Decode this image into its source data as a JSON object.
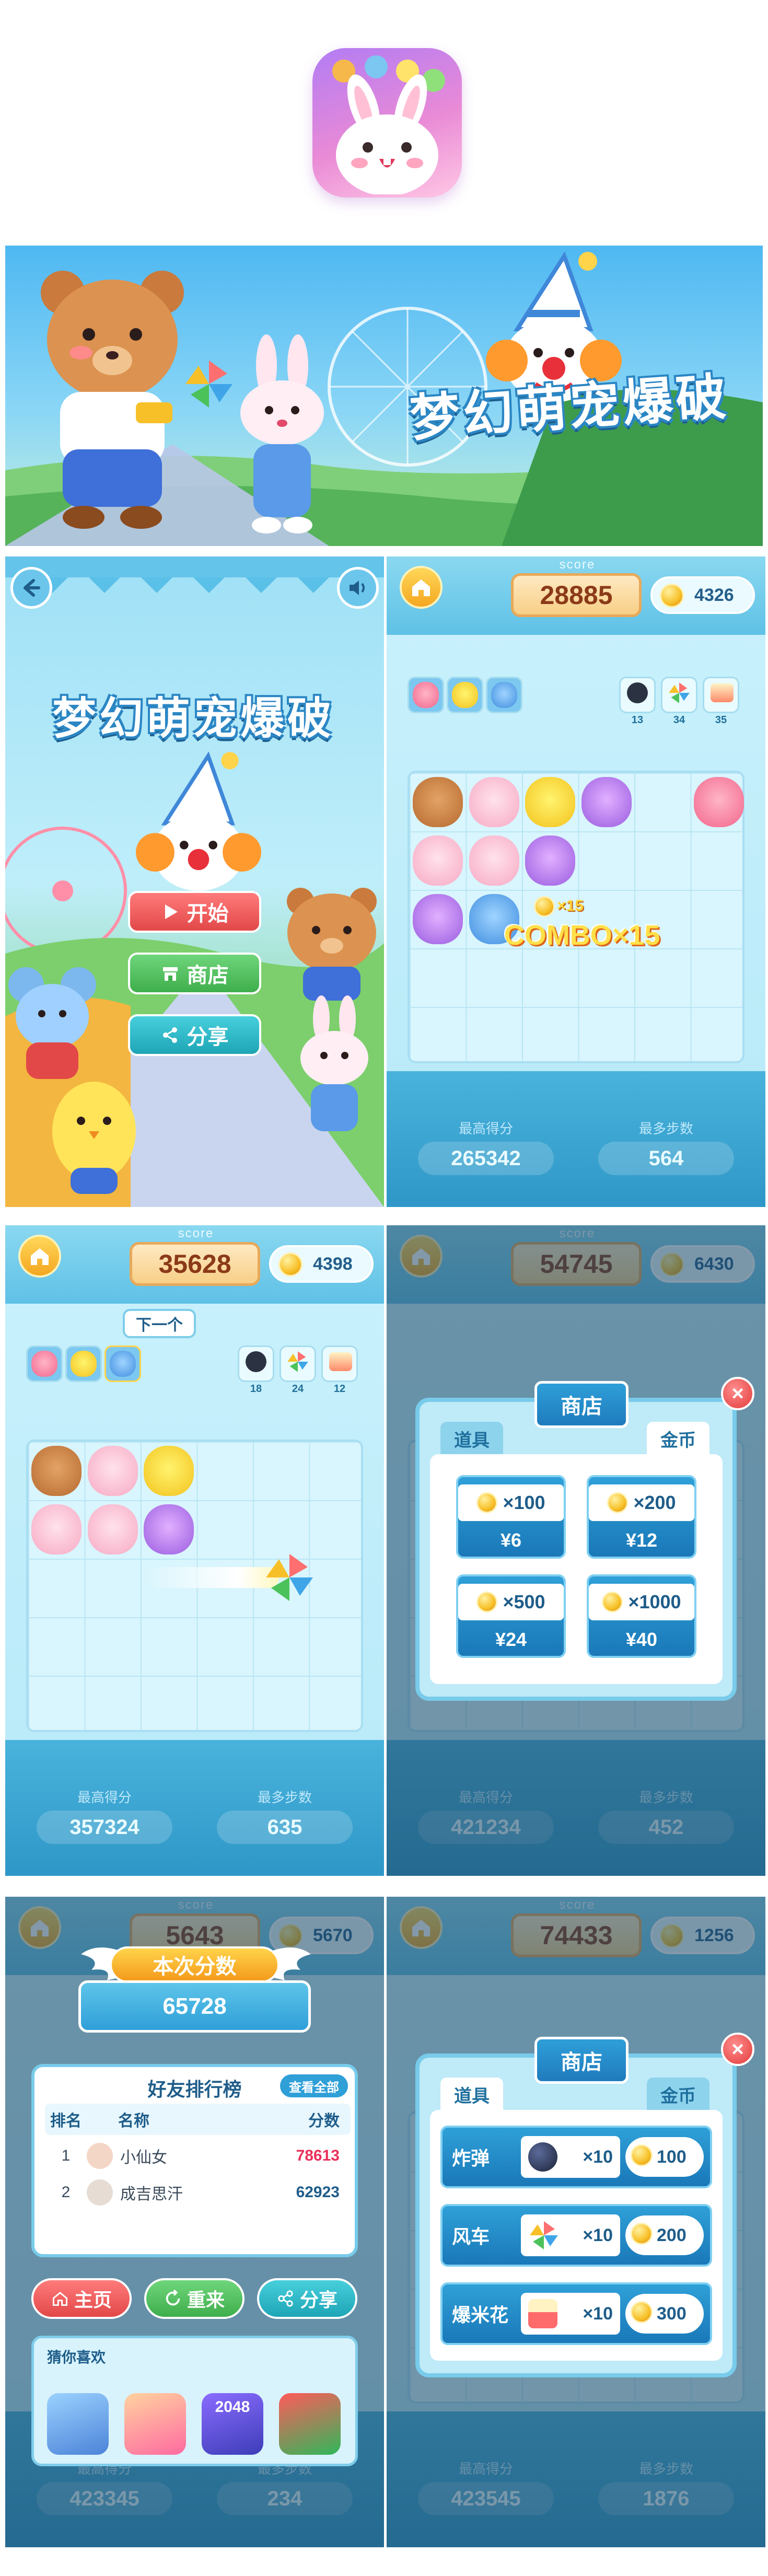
{
  "colors": {
    "accent_blue": "#2f9fd8",
    "coin_gold": "#f7c028",
    "score_brown": "#8b3a18",
    "start_red": "#ef5a5a",
    "shop_green": "#4cc25a",
    "share_teal": "#2fb7c6"
  },
  "game_title": "梦幻萌宠爆破",
  "menu": {
    "start_label": "开始",
    "shop_label": "商店",
    "share_label": "分享",
    "start_icon": "play-icon",
    "shop_icon": "store-icon",
    "share_icon": "share-icon"
  },
  "common": {
    "score_caption": "score",
    "best_score_label": "最高得分",
    "most_steps_label": "最多步数"
  },
  "screen_combo": {
    "score": "28885",
    "coins": "4326",
    "powerups": [
      "13",
      "34",
      "35"
    ],
    "combo_small": "×15",
    "combo_text": "COMBO×15",
    "best_score": "265342",
    "most_steps": "564"
  },
  "screen_tutorial": {
    "score": "35628",
    "coins": "4398",
    "hint": "下一个",
    "powerups": [
      "18",
      "24",
      "12"
    ],
    "best_score": "357324",
    "most_steps": "635"
  },
  "screen_shop_coins": {
    "score": "54745",
    "coins": "6430",
    "title": "商店",
    "tab_items": "道具",
    "tab_coins": "金币",
    "close_icon": "close-icon",
    "packs": [
      {
        "amount": "×100",
        "price": "¥6"
      },
      {
        "amount": "×200",
        "price": "¥12"
      },
      {
        "amount": "×500",
        "price": "¥24"
      },
      {
        "amount": "×1000",
        "price": "¥40"
      }
    ],
    "best_score": "421234",
    "most_steps": "452"
  },
  "screen_results": {
    "score_partial": "5643",
    "coins": "5670",
    "result_title": "本次分数",
    "result_score": "65728",
    "leaderboard_title": "好友排行榜",
    "view_all": "查看全部",
    "columns": [
      "排名",
      "名称",
      "分数"
    ],
    "rows": [
      {
        "rank": "1",
        "name": "小仙女",
        "score": "78613"
      },
      {
        "rank": "2",
        "name": "成吉思汗",
        "score": "62923"
      }
    ],
    "btn_home": "主页",
    "btn_replay": "重来",
    "btn_share": "分享",
    "suggest_title": "猜你喜欢",
    "games": [
      {
        "label": "",
        "icon": "koala-game-icon"
      },
      {
        "label": "",
        "icon": "princess-game-icon"
      },
      {
        "label": "2048",
        "icon": "2048-game-icon"
      },
      {
        "label": "",
        "icon": "chick-game-icon"
      }
    ],
    "best_score": "423345",
    "most_steps": "234"
  },
  "screen_shop_items": {
    "score": "74433",
    "coins": "1256",
    "title": "商店",
    "tab_items": "道具",
    "tab_coins": "金币",
    "items": [
      {
        "name": "炸弹",
        "qty": "×10",
        "cost": "100",
        "icon": "bomb-icon"
      },
      {
        "name": "风车",
        "qty": "×10",
        "cost": "200",
        "icon": "pinwheel-icon"
      },
      {
        "name": "爆米花",
        "qty": "×10",
        "cost": "300",
        "icon": "popcorn-icon"
      }
    ],
    "best_score": "423545",
    "most_steps": "1876"
  }
}
